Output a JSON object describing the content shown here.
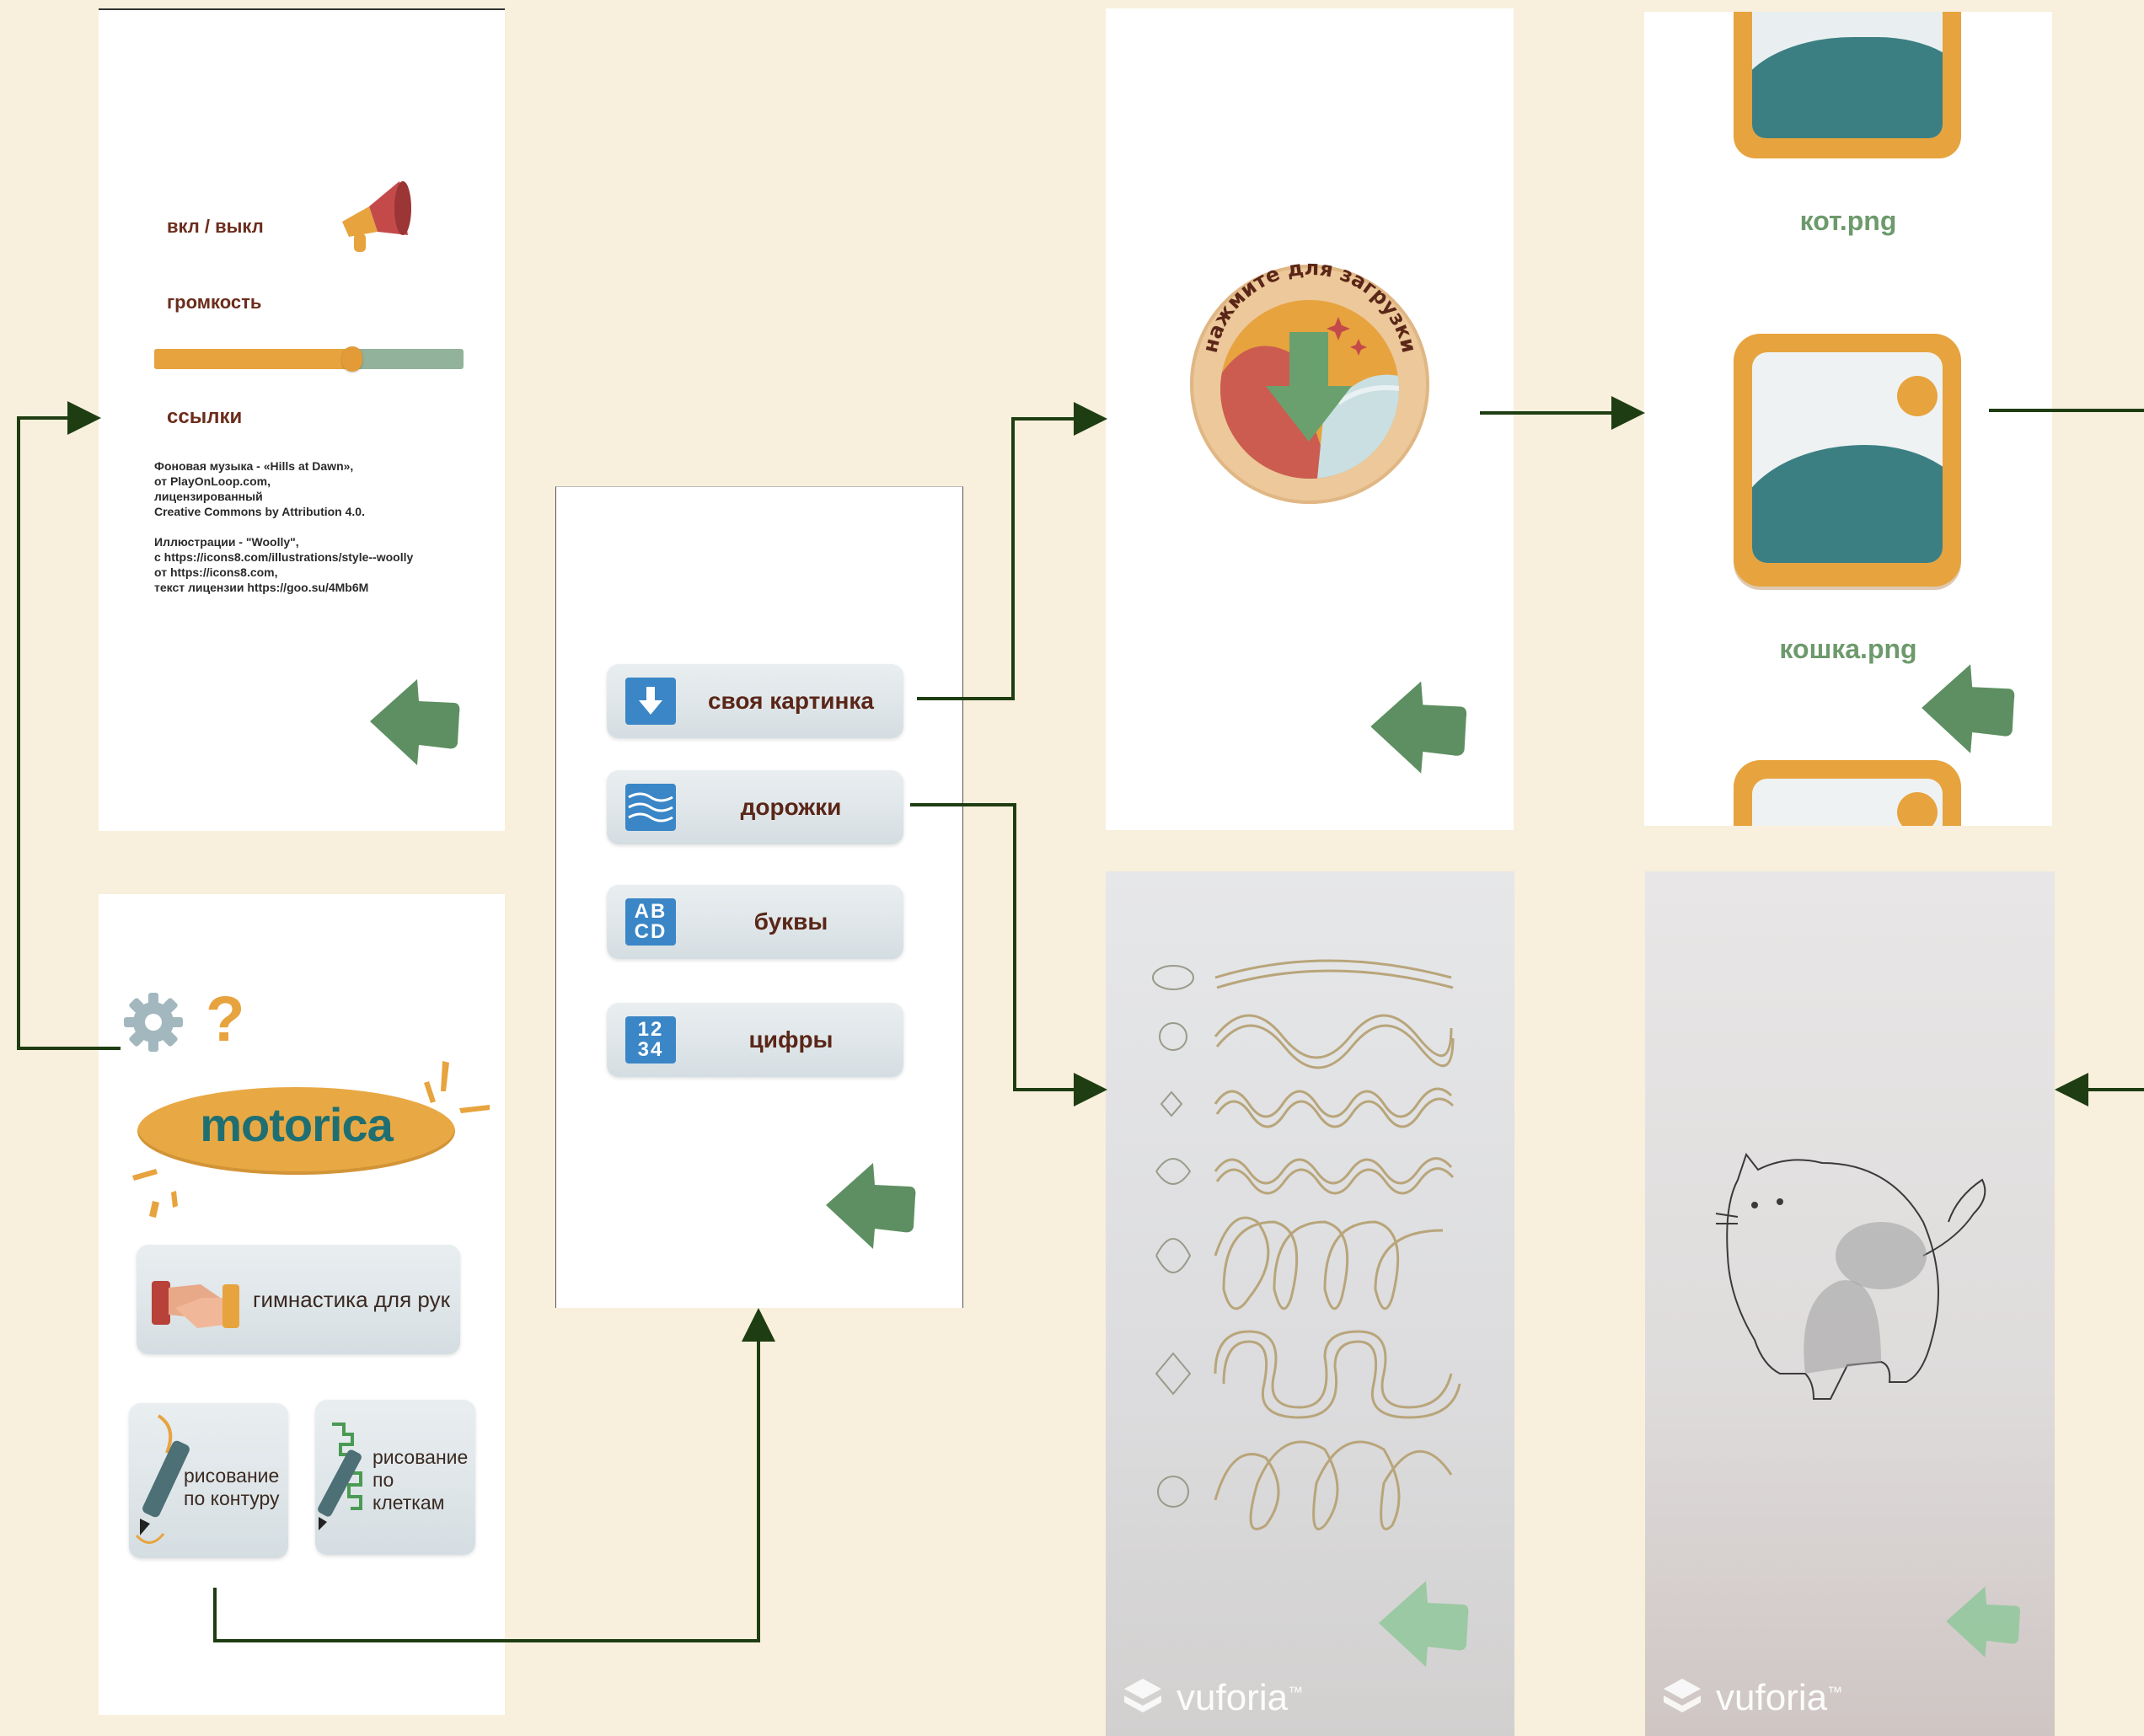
{
  "settings_screen": {
    "sound_toggle_label": "вкл / выкл",
    "volume_label": "громкость",
    "volume_level": 0.64,
    "links_label": "ссылки",
    "credits_text": "Фоновая музыка - «Hills at Dawn»,\nот PlayOnLoop.com,\nлицензированный\nCreative Commons by Attribution 4.0.\n\nИллюстрации  - \"Woolly\",\nс https://icons8.com/illustrations/style--woolly\nот https://icons8.com,\nтекст лицензии https://goo.su/4Mb6M",
    "back_icon": "back-arrow-icon"
  },
  "main_screen": {
    "settings_icon": "gear-icon",
    "help_symbol": "?",
    "logo_text": "motorica",
    "gymnastics_label": "гимнастика для рук",
    "contour_label": "рисование\nпо контуру",
    "grid_label": "рисование\nпо\nклеткам"
  },
  "drawing_menu": {
    "items": [
      {
        "label": "своя картинка",
        "icon": "download-icon"
      },
      {
        "label": "дорожки",
        "icon": "waves-icon"
      },
      {
        "label": "буквы",
        "icon_text": "AB\nCD"
      },
      {
        "label": "цифры",
        "icon_text": "12\n34"
      }
    ]
  },
  "upload_screen": {
    "badge_text": "нажмите для загрузки"
  },
  "gallery_screen": {
    "files": [
      "кот.png",
      "кошка.png"
    ]
  },
  "ar_screens": {
    "brand": "vuforia",
    "brand_mark": "™"
  },
  "colors": {
    "background": "#f8efdc",
    "accent_orange": "#e7a33e",
    "accent_green": "#6d9a6c",
    "text_brown": "#6b2d1c",
    "arrow_green": "#1e3d12",
    "menu_icon_blue": "#3a86c6"
  }
}
